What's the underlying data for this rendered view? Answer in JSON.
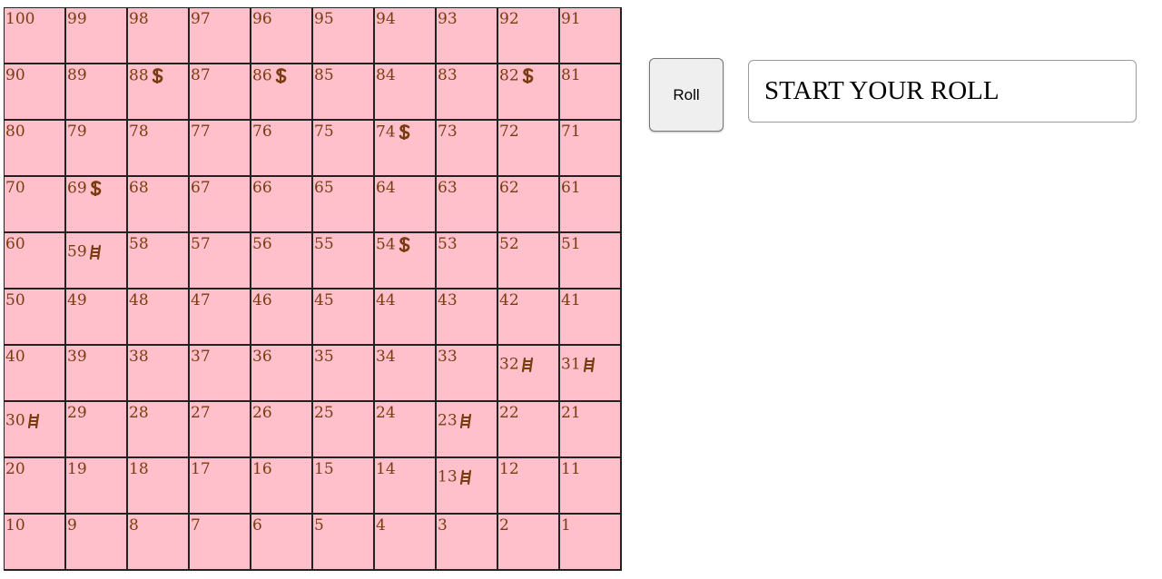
{
  "board": {
    "rows": [
      [
        {
          "n": "100"
        },
        {
          "n": "99"
        },
        {
          "n": "98"
        },
        {
          "n": "97"
        },
        {
          "n": "96"
        },
        {
          "n": "95"
        },
        {
          "n": "94"
        },
        {
          "n": "93"
        },
        {
          "n": "92"
        },
        {
          "n": "91"
        }
      ],
      [
        {
          "n": "90"
        },
        {
          "n": "89"
        },
        {
          "n": "88",
          "m": "snake"
        },
        {
          "n": "87"
        },
        {
          "n": "86",
          "m": "snake"
        },
        {
          "n": "85"
        },
        {
          "n": "84"
        },
        {
          "n": "83"
        },
        {
          "n": "82",
          "m": "snake"
        },
        {
          "n": "81"
        }
      ],
      [
        {
          "n": "80"
        },
        {
          "n": "79"
        },
        {
          "n": "78"
        },
        {
          "n": "77"
        },
        {
          "n": "76"
        },
        {
          "n": "75"
        },
        {
          "n": "74",
          "m": "snake"
        },
        {
          "n": "73"
        },
        {
          "n": "72"
        },
        {
          "n": "71"
        }
      ],
      [
        {
          "n": "70"
        },
        {
          "n": "69",
          "m": "snake"
        },
        {
          "n": "68"
        },
        {
          "n": "67"
        },
        {
          "n": "66"
        },
        {
          "n": "65"
        },
        {
          "n": "64"
        },
        {
          "n": "63"
        },
        {
          "n": "62"
        },
        {
          "n": "61"
        }
      ],
      [
        {
          "n": "60"
        },
        {
          "n": "59",
          "m": "ladder"
        },
        {
          "n": "58"
        },
        {
          "n": "57"
        },
        {
          "n": "56"
        },
        {
          "n": "55"
        },
        {
          "n": "54",
          "m": "snake"
        },
        {
          "n": "53"
        },
        {
          "n": "52"
        },
        {
          "n": "51"
        }
      ],
      [
        {
          "n": "50"
        },
        {
          "n": "49"
        },
        {
          "n": "48"
        },
        {
          "n": "47"
        },
        {
          "n": "46"
        },
        {
          "n": "45"
        },
        {
          "n": "44"
        },
        {
          "n": "43"
        },
        {
          "n": "42"
        },
        {
          "n": "41"
        }
      ],
      [
        {
          "n": "40"
        },
        {
          "n": "39"
        },
        {
          "n": "38"
        },
        {
          "n": "37"
        },
        {
          "n": "36"
        },
        {
          "n": "35"
        },
        {
          "n": "34"
        },
        {
          "n": "33"
        },
        {
          "n": "32",
          "m": "ladder"
        },
        {
          "n": "31",
          "m": "ladder"
        }
      ],
      [
        {
          "n": "30",
          "m": "ladder"
        },
        {
          "n": "29"
        },
        {
          "n": "28"
        },
        {
          "n": "27"
        },
        {
          "n": "26"
        },
        {
          "n": "25"
        },
        {
          "n": "24"
        },
        {
          "n": "23",
          "m": "ladder"
        },
        {
          "n": "22"
        },
        {
          "n": "21"
        }
      ],
      [
        {
          "n": "20"
        },
        {
          "n": "19"
        },
        {
          "n": "18"
        },
        {
          "n": "17"
        },
        {
          "n": "16"
        },
        {
          "n": "15"
        },
        {
          "n": "14"
        },
        {
          "n": "13",
          "m": "ladder"
        },
        {
          "n": "12"
        },
        {
          "n": "11"
        }
      ],
      [
        {
          "n": "10"
        },
        {
          "n": "9"
        },
        {
          "n": "8"
        },
        {
          "n": "7"
        },
        {
          "n": "6"
        },
        {
          "n": "5"
        },
        {
          "n": "4"
        },
        {
          "n": "3"
        },
        {
          "n": "2"
        },
        {
          "n": "1"
        }
      ]
    ],
    "marker_icons": {
      "snake": "snake-icon",
      "ladder": "ladder-icon"
    },
    "colors": {
      "cell": "#ffc0cb",
      "text": "#7a3b10",
      "grid": "#222222"
    }
  },
  "controls": {
    "roll_label": "Roll",
    "status_text": "START YOUR ROLL"
  }
}
